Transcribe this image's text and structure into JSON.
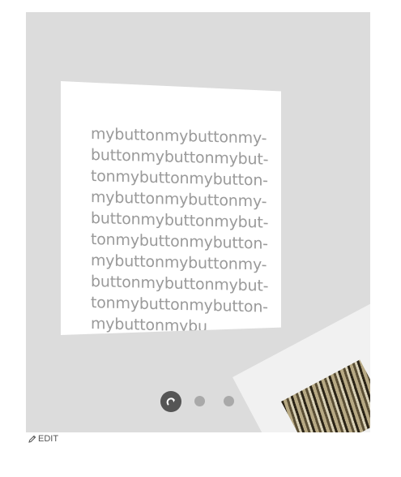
{
  "card": {
    "text": "mybuttonmybuttonmy-\nbuttonmybuttonmybut-\ntonmybuttonmybutton-\nmybuttonmybuttonmy-\nbuttonmybuttonmybut-\ntonmybuttonmybutton-\nmybuttonmybuttonmy-\nbuttonmybuttonmybut-\ntonmybuttonmybutton-\nmybuttonmybu"
  },
  "pagination": {
    "active_icon": "reload-icon",
    "dots": 3,
    "active_index": 0
  },
  "footer": {
    "edit_label": "EDIT",
    "edit_icon": "pencil-icon"
  },
  "colors": {
    "stage_bg": "#dcdcdc",
    "card_text": "#9a9a9a",
    "dot_active": "#555555",
    "dot_inactive": "#a9a9a9"
  }
}
